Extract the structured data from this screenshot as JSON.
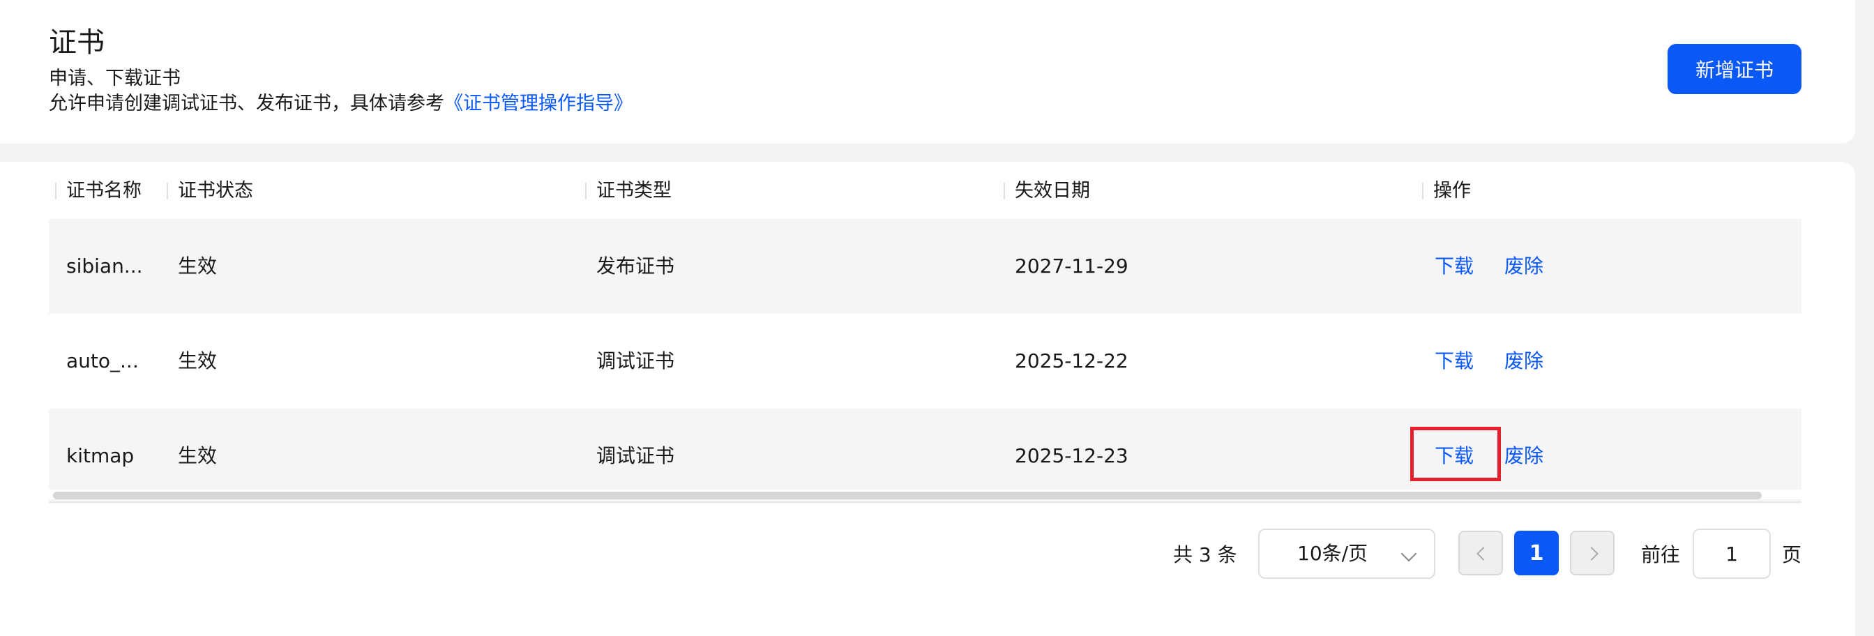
{
  "header": {
    "title": "证书",
    "subtitle": "申请、下载证书",
    "description": "允许申请创建调试证书、发布证书，具体请参考",
    "guide_link": "《证书管理操作指导》",
    "add_button": "新增证书"
  },
  "table": {
    "columns": [
      "证书名称",
      "证书状态",
      "证书类型",
      "失效日期",
      "操作"
    ],
    "rows": [
      {
        "name": "sibian...",
        "status": "生效",
        "type": "发布证书",
        "expiry": "2027-11-29",
        "download": "下载",
        "revoke": "废除"
      },
      {
        "name": "auto_...",
        "status": "生效",
        "type": "调试证书",
        "expiry": "2025-12-22",
        "download": "下载",
        "revoke": "废除"
      },
      {
        "name": "kitmap",
        "status": "生效",
        "type": "调试证书",
        "expiry": "2025-12-23",
        "download": "下载",
        "revoke": "废除"
      }
    ]
  },
  "pagination": {
    "total": "共 3 条",
    "page_size": "10条/页",
    "current_page": "1",
    "goto_label": "前往",
    "goto_value": "1",
    "page_suffix": "页"
  },
  "colors": {
    "accent": "#0a59f7",
    "highlight": "#e5202e",
    "row_alt": "#f5f5f5"
  }
}
